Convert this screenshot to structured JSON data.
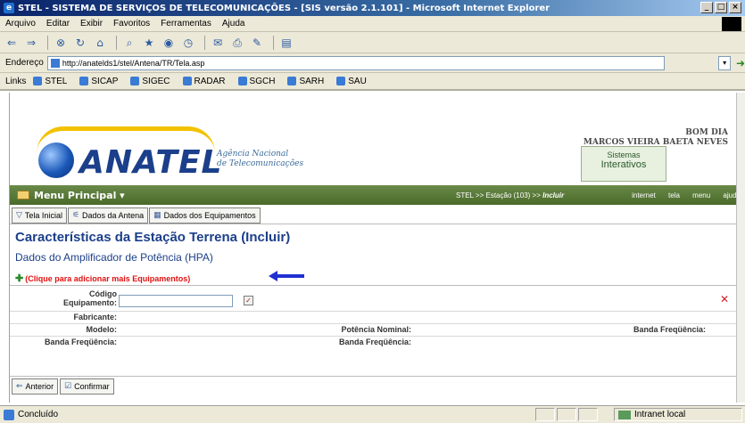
{
  "window": {
    "title": "STEL - SISTEMA DE SERVIÇOS DE TELECOMUNICAÇÕES - [SIS versão 2.1.101] - Microsoft Internet Explorer"
  },
  "menubar": [
    "Arquivo",
    "Editar",
    "Exibir",
    "Favoritos",
    "Ferramentas",
    "Ajuda"
  ],
  "address": {
    "label": "Endereço",
    "url": "http://anatelds1/stel/Antena/TR/Tela.asp"
  },
  "links": {
    "label": "Links",
    "items": [
      "STEL",
      "SICAP",
      "SIGEC",
      "RADAR",
      "SGCH",
      "SARH",
      "SAU"
    ]
  },
  "header": {
    "logo": "ANATEL",
    "subtitle_line1": "Agência Nacional",
    "subtitle_line2": "de Telecomunicações",
    "greeting_line1": "BOM DIA",
    "greeting_line2": "MARCOS VIEIRA BAETA NEVES",
    "sistemas_line1": "Sistemas",
    "sistemas_line2": "Interativos"
  },
  "menu_strip": {
    "menu_principal": "Menu Principal ▾",
    "crumb_prefix": "STEL >> Estação (103) >>",
    "crumb_current": "Incluir",
    "links": [
      "internet",
      "tela",
      "menu",
      "ajuda"
    ]
  },
  "tabs": [
    "Tela Inicial",
    "Dados da Antena",
    "Dados dos Equipamentos"
  ],
  "content": {
    "title": "Características da Estação Terrena (Incluir)",
    "subtitle": "Dados do Amplificador de Potência (HPA)",
    "add_equipment": "(Clique para adicionar mais Equipamentos)",
    "fields": {
      "codigo_line1": "Código",
      "codigo_line2": "Equipamento:",
      "fabricante": "Fabricante:",
      "modelo": "Modelo:",
      "potencia_nominal": "Potência Nominal:",
      "banda_frequencia": "Banda Freqüência:"
    }
  },
  "bottom_buttons": [
    "Anterior",
    "Confirmar"
  ],
  "status": {
    "text": "Concluído",
    "zone": "Intranet local"
  }
}
